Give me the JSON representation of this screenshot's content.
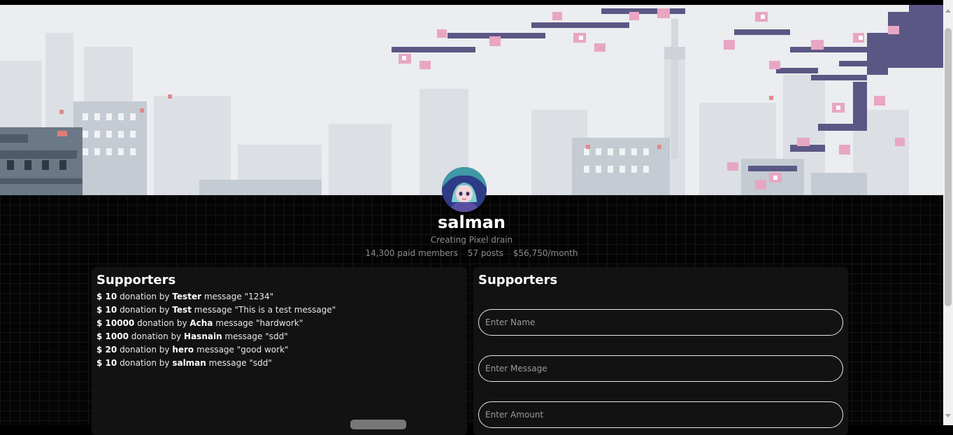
{
  "profile": {
    "username": "salman",
    "tagline": "Creating Pixel drain",
    "stats": {
      "members": "14,300 paid members",
      "posts": "57 posts",
      "earnings": "$56,750/month"
    }
  },
  "supporters_panel": {
    "title": "Supporters",
    "donations": [
      {
        "amount": "$ 10",
        "by": "donation by",
        "name": "Tester",
        "message": "message \"1234\""
      },
      {
        "amount": "$ 10",
        "by": "donation by",
        "name": "Test",
        "message": "message \"This is a test message\""
      },
      {
        "amount": "$ 10000",
        "by": "donation by",
        "name": "Acha",
        "message": "message \"hardwork\""
      },
      {
        "amount": "$ 1000",
        "by": "donation by",
        "name": "Hasnain",
        "message": "message \"sdd\""
      },
      {
        "amount": "$ 20",
        "by": "donation by",
        "name": "hero",
        "message": "message \"good work\""
      },
      {
        "amount": "$ 10",
        "by": "donation by",
        "name": "salman",
        "message": "message \"sdd\""
      }
    ]
  },
  "form_panel": {
    "title": "Supporters",
    "name_placeholder": "Enter Name",
    "message_placeholder": "Enter Message",
    "amount_placeholder": "Enter Amount"
  },
  "icons": {
    "cover": "pixel-city-cherry-blossom-illustration",
    "avatar": "anime-character-avatar"
  },
  "colors": {
    "background": "#040404",
    "panel": "#121212",
    "blossom": "#e8a6c3",
    "branch": "#5b5784"
  }
}
